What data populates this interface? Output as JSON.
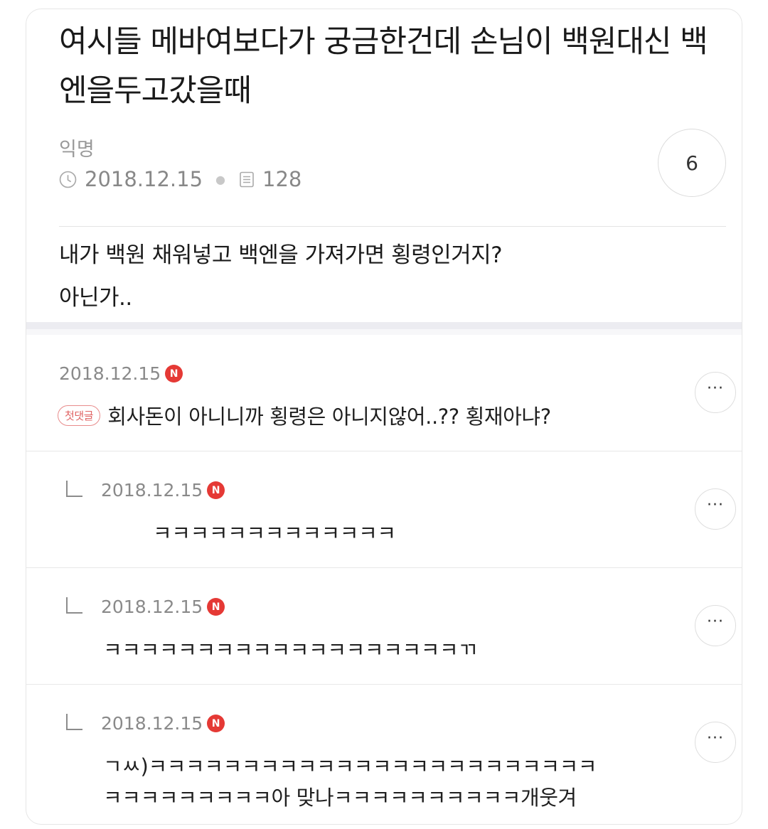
{
  "post": {
    "title": "여시들 메바여보다가 궁금한건데 손님이 백원대신 백엔을두고갔을때",
    "author": "익명",
    "date": "2018.12.15",
    "views": "128",
    "comment_count": "6",
    "body_line1": "내가 백원 채워넣고 백엔을 가져가면 횡령인거지?",
    "body_line2": "아닌가.."
  },
  "comments": [
    {
      "date": "2018.12.15",
      "badge": "N",
      "first_label": "첫댓글",
      "text": "회사돈이 아니니까 횡령은 아니지않어..?? 횡재아냐?",
      "more": "···"
    },
    {
      "date": "2018.12.15",
      "badge": "N",
      "text": "ㅋㅋㅋㅋㅋㅋㅋㅋㅋㅋㅋㅋㅋ",
      "more": "···"
    },
    {
      "date": "2018.12.15",
      "badge": "N",
      "text": "ㅋㅋㅋㅋㅋㅋㅋㅋㅋㅋㅋㅋㅋㅋㅋㅋㅋㅋㅋㄲ",
      "more": "···"
    },
    {
      "date": "2018.12.15",
      "badge": "N",
      "text_line1": "ㄱㅆ)ㅋㅋㅋㅋㅋㅋㅋㅋㅋㅋㅋㅋㅋㅋㅋㅋㅋㅋㅋㅋㅋㅋㅋㅋ",
      "text_line2": "ㅋㅋㅋㅋㅋㅋㅋㅋㅋ아 맞나ㅋㅋㅋㅋㅋㅋㅋㅋㅋㅋ개웃겨",
      "more": "···"
    }
  ],
  "colors": {
    "badge_red": "#e53935",
    "first_badge": "#e06464"
  },
  "icons": {
    "date": "clock-icon",
    "views": "document-icon",
    "reply": "reply-arrow-icon",
    "more": "more-icon"
  }
}
